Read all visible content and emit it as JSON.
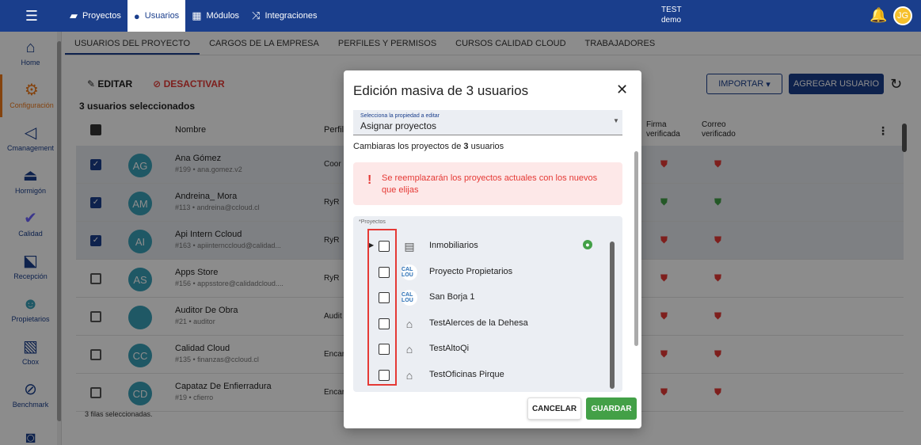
{
  "topbar": {
    "nav": [
      {
        "label": "Proyectos",
        "icon": "briefcase-icon"
      },
      {
        "label": "Usuarios",
        "icon": "user-icon"
      },
      {
        "label": "Módulos",
        "icon": "grid-icon"
      },
      {
        "label": "Integraciones",
        "icon": "shuffle-icon"
      }
    ],
    "env_line1": "TEST",
    "env_line2": "demo",
    "avatar_initials": "JG"
  },
  "sidebar": {
    "items": [
      {
        "label": "Home",
        "icon": "home-icon"
      },
      {
        "label": "Configuración",
        "icon": "gear-icon"
      },
      {
        "label": "Cmanagement",
        "icon": "cmanagement-icon"
      },
      {
        "label": "Hormigón",
        "icon": "wheelbarrow-icon"
      },
      {
        "label": "Calidad",
        "icon": "check-icon"
      },
      {
        "label": "Recepción",
        "icon": "reception-icon"
      },
      {
        "label": "Propietarios",
        "icon": "people-icon"
      },
      {
        "label": "Cbox",
        "icon": "board-icon"
      },
      {
        "label": "Benchmark",
        "icon": "telescope-icon"
      },
      {
        "label": "",
        "icon": "more-icon"
      }
    ]
  },
  "tabs": [
    "USUARIOS DEL PROYECTO",
    "CARGOS DE LA EMPRESA",
    "PERFILES Y PERMISOS",
    "CURSOS CALIDAD CLOUD",
    "TRABAJADORES"
  ],
  "toolbar": {
    "edit": "EDITAR",
    "deactivate": "DESACTIVAR",
    "selected": "3 usuarios seleccionados",
    "import": "IMPORTAR",
    "add_user": "AGREGAR USUARIO"
  },
  "table": {
    "headers": {
      "name": "Nombre",
      "profile": "Perfil",
      "signature": "Firma verificada",
      "email": "Correo verificado"
    },
    "rows": [
      {
        "initials": "AG",
        "name": "Ana Gómez",
        "sub": "#199 • ana.gomez.v2",
        "perfil": "Coor",
        "selected": true,
        "firma": "red",
        "correo": "red"
      },
      {
        "initials": "AM",
        "name": "Andreina_ Mora",
        "sub": "#113 • andreina@ccloud.cl",
        "perfil": "RyR",
        "selected": true,
        "firma": "green",
        "correo": "green"
      },
      {
        "initials": "AI",
        "name": "Api Intern Ccloud",
        "sub": "#163 • apiinternccloud@calidad...",
        "perfil": "RyR",
        "selected": true,
        "firma": "red",
        "correo": "red"
      },
      {
        "initials": "AS",
        "name": "Apps Store",
        "sub": "#156 • appsstore@calidadcloud....",
        "perfil": "RyR",
        "selected": false,
        "firma": "red",
        "correo": "red"
      },
      {
        "initials": "",
        "name": "Auditor De Obra",
        "sub": "#21 • auditor",
        "perfil": "Audit",
        "selected": false,
        "firma": "red",
        "correo": "red"
      },
      {
        "initials": "CC",
        "name": "Calidad Cloud",
        "sub": "#135 • finanzas@ccloud.cl",
        "perfil": "Encar",
        "selected": false,
        "firma": "red",
        "correo": "red"
      },
      {
        "initials": "CD",
        "name": "Capataz De Enfierradura",
        "sub": "#19 • cfierro",
        "perfil": "Encar",
        "selected": false,
        "firma": "red",
        "correo": "red"
      }
    ],
    "footer": "3 filas seleccionadas."
  },
  "modal": {
    "title": "Edición masiva de 3 usuarios",
    "select_label": "Selecciona la propiedad a editar",
    "select_value": "Asignar proyectos",
    "desc_prefix": "Cambiaras los proyectos de ",
    "desc_count": "3",
    "desc_suffix": " usuarios",
    "warning": "Se reemplazarán los proyectos actuales con los nuevos que elijas",
    "list_label": "*Proyectos",
    "projects": [
      {
        "name": "Inmobiliarios",
        "icon": "building-icon",
        "expandable": true,
        "badge": true
      },
      {
        "name": "Proyecto Propietarios",
        "icon": "calcloud-logo-icon",
        "expandable": false,
        "badge": false
      },
      {
        "name": "San Borja 1",
        "icon": "calcloud-logo-icon",
        "expandable": false,
        "badge": false
      },
      {
        "name": "TestAlerces de la Dehesa",
        "icon": "house-icon",
        "expandable": false,
        "badge": false
      },
      {
        "name": "TestAltoQi",
        "icon": "house-icon",
        "expandable": false,
        "badge": false
      },
      {
        "name": "TestOficinas Pirque",
        "icon": "house-icon",
        "expandable": false,
        "badge": false
      }
    ],
    "logo_text": "CAL LOU",
    "cancel": "CANCELAR",
    "save": "GUARDAR"
  }
}
